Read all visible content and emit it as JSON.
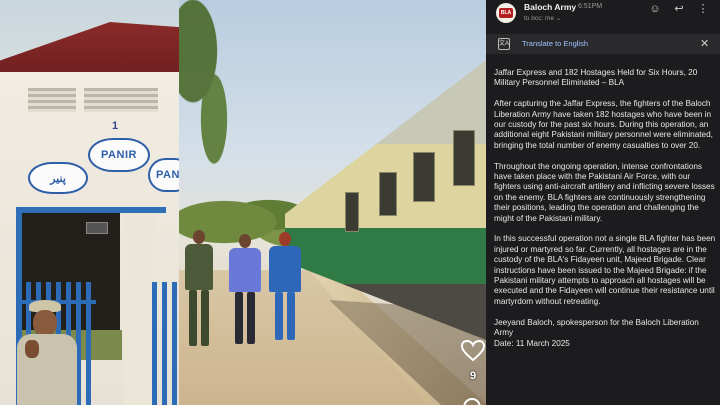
{
  "station": {
    "number": "1",
    "sign_left": "پنیر",
    "sign_middle": "PANIR",
    "sign_right": "PANIR"
  },
  "post": {
    "likes": "9"
  },
  "email": {
    "sender": "Baloch Army",
    "time": "6:51PM",
    "to": "to bcc: me ⌄",
    "translate_label": "Translate to English",
    "paragraphs": [
      "Jaffar Express and 182 Hostages Held for Six Hours, 20 Military Personnel Eliminated – BLA",
      "After capturing the Jaffar Express, the fighters of the Baloch Liberation Army have taken 182 hostages who have been in our custody for the past six hours. During this operation, an additional eight Pakistani military personnel were eliminated, bringing the total number of enemy casualties to over 20.",
      "Throughout the ongoing operation, intense confrontations have taken place with the Pakistani Air Force, with our fighters using anti-aircraft artillery and inflicting severe losses on the enemy. BLA fighters are continuously strengthening their positions, leading the operation and challenging the might of the Pakistani military.",
      "In this successful operation not a single BLA fighter has been injured or martyred so far. Currently, all hostages are in the custody of the BLA's Fidayeen unit, Majeed Brigade. Clear instructions have been issued to the Majeed Brigade: if the Pakistani military attempts to approach all hostages will be executed and the Fidayeen will continue their resistance until martyrdom without retreating.",
      "Jeeyand Baloch, spokesperson for the Baloch Liberation Army\nDate: 11 March 2025"
    ]
  },
  "icons": {
    "emoji": "emoji-icon",
    "reply": "reply-icon",
    "more": "more-icon",
    "translate": "translate-icon",
    "close": "close-icon",
    "heart": "heart-icon"
  }
}
